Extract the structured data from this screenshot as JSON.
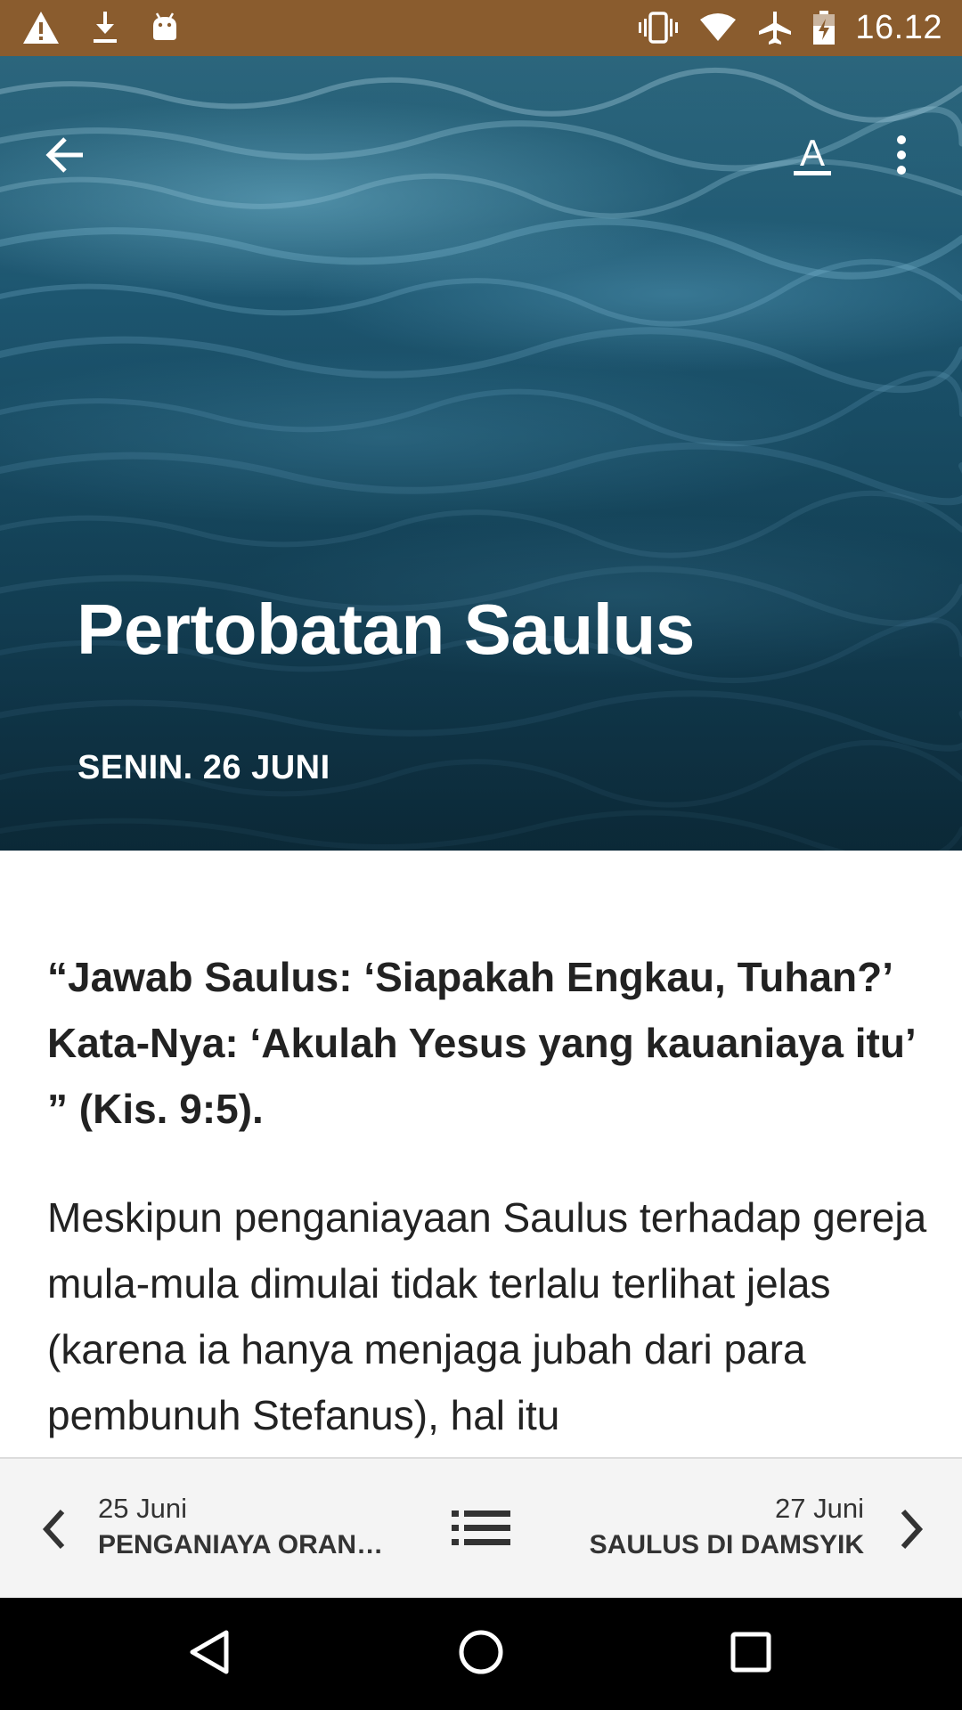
{
  "status_bar": {
    "time": "16.12",
    "icons_left": [
      "warning-icon",
      "download-icon",
      "android-icon"
    ],
    "icons_right": [
      "vibrate-icon",
      "wifi-icon",
      "airplane-icon",
      "battery-icon"
    ],
    "background": "#8a5c2e"
  },
  "hero": {
    "title": "Pertobatan Saulus",
    "date": "SENIN. 26 JUNI"
  },
  "toolbar": {
    "back_icon": "arrow-back-icon",
    "font_icon": "font-size-icon",
    "font_label": "A",
    "more_icon": "more-vert-icon"
  },
  "content": {
    "verse": "“Jawab Saulus: ‘Siapakah Engkau, Tuhan?’ Kata-Nya: ‘Akulah Yesus yang kauaniaya itu’ ” (Kis. 9:5).",
    "body": "Meskipun penganiayaan Saulus terhadap gereja mula-mula dimulai tidak terlalu terlihat jelas (karena ia hanya menjaga jubah dari para pembunuh Stefanus), hal itu"
  },
  "bottom_nav": {
    "prev": {
      "date": "25 Juni",
      "title": "PENGANIAYA ORAN…"
    },
    "next": {
      "date": "27 Juni",
      "title": "SAULUS DI DAMSYIK"
    },
    "toc_icon": "list-icon"
  },
  "system_nav": {
    "back": "nav-back-icon",
    "home": "nav-home-icon",
    "recent": "nav-recent-icon"
  }
}
